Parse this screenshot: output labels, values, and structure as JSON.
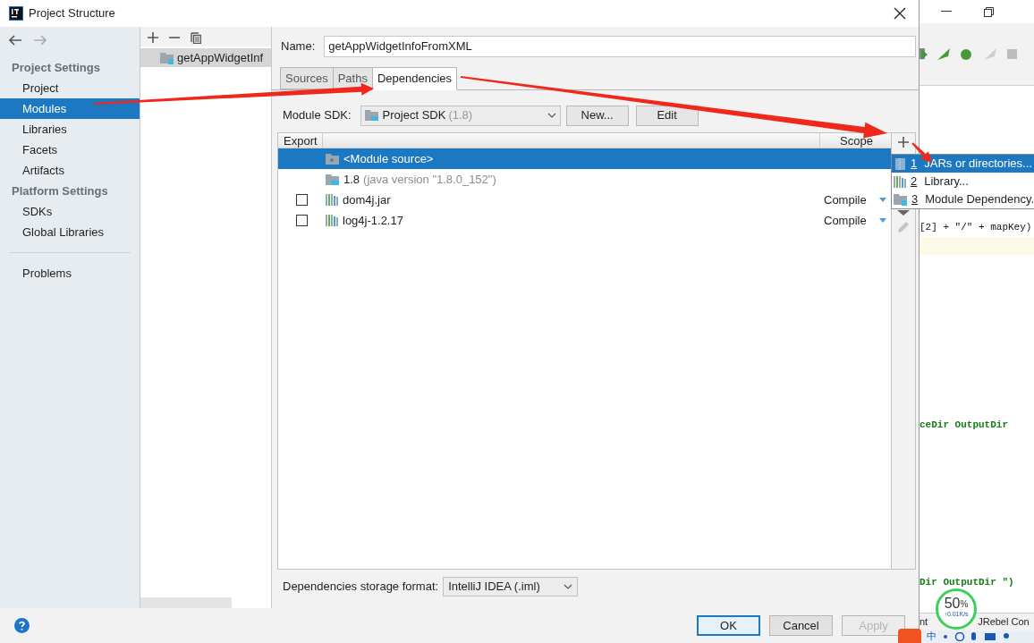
{
  "window": {
    "title": "Project Structure"
  },
  "sidebar": {
    "sections": [
      {
        "heading": "Project Settings",
        "items": [
          {
            "label": "Project",
            "selected": false
          },
          {
            "label": "Modules",
            "selected": true
          },
          {
            "label": "Libraries",
            "selected": false
          },
          {
            "label": "Facets",
            "selected": false
          },
          {
            "label": "Artifacts",
            "selected": false
          }
        ]
      },
      {
        "heading": "Platform Settings",
        "items": [
          {
            "label": "SDKs",
            "selected": false
          },
          {
            "label": "Global Libraries",
            "selected": false
          }
        ]
      }
    ],
    "extra_items": [
      {
        "label": "Problems",
        "selected": false
      }
    ]
  },
  "modules": {
    "items": [
      {
        "name": "getAppWidgetInf",
        "selected": true
      }
    ]
  },
  "name_field": {
    "label": "Name:",
    "value": "getAppWidgetInfoFromXML"
  },
  "tabs": [
    {
      "label": "Sources",
      "selected": false
    },
    {
      "label": "Paths",
      "selected": false
    },
    {
      "label": "Dependencies",
      "selected": true
    }
  ],
  "sdk": {
    "label": "Module SDK:",
    "value": "Project SDK",
    "version": "(1.8)",
    "buttons": [
      "New...",
      "Edit"
    ]
  },
  "table": {
    "columns": [
      "Export",
      "Scope"
    ],
    "rows": [
      {
        "kind": "source",
        "name": "<Module source>",
        "selected": true
      },
      {
        "kind": "sdk",
        "name": "1.8",
        "detail": "(java version \"1.8.0_152\")",
        "selected": false
      },
      {
        "kind": "library",
        "name": "dom4j.jar",
        "checked": false,
        "scope": "Compile",
        "selected": false
      },
      {
        "kind": "library",
        "name": "log4j-1.2.17",
        "checked": false,
        "scope": "Compile",
        "selected": false
      }
    ]
  },
  "popup_menu": {
    "items": [
      {
        "kind": "jar",
        "number": "1",
        "label": "JARs or directories...",
        "selected": true
      },
      {
        "kind": "library",
        "number": "2",
        "label": "Library...",
        "selected": false
      },
      {
        "kind": "module",
        "number": "3",
        "label": "Module Dependency.",
        "selected": false
      }
    ]
  },
  "storage": {
    "label": "Dependencies storage format:",
    "value": "IntelliJ IDEA (.iml)"
  },
  "buttons": [
    {
      "label": "OK",
      "default": true,
      "disabled": false
    },
    {
      "label": "Cancel",
      "default": false,
      "disabled": false
    },
    {
      "label": "Apply",
      "default": false,
      "disabled": true
    }
  ],
  "background_ide": {
    "code_lines": [
      "[2] + \"/\" + mapKey)",
      "ceDir OutputDir",
      "Dir OutputDir \")"
    ],
    "status_texts": [
      "nt",
      "JRebel Con"
    ],
    "network_widget": {
      "percent": "50",
      "unit": "%",
      "speed": "↑0.01K/s"
    },
    "taskbar": {
      "ime": "中"
    }
  }
}
